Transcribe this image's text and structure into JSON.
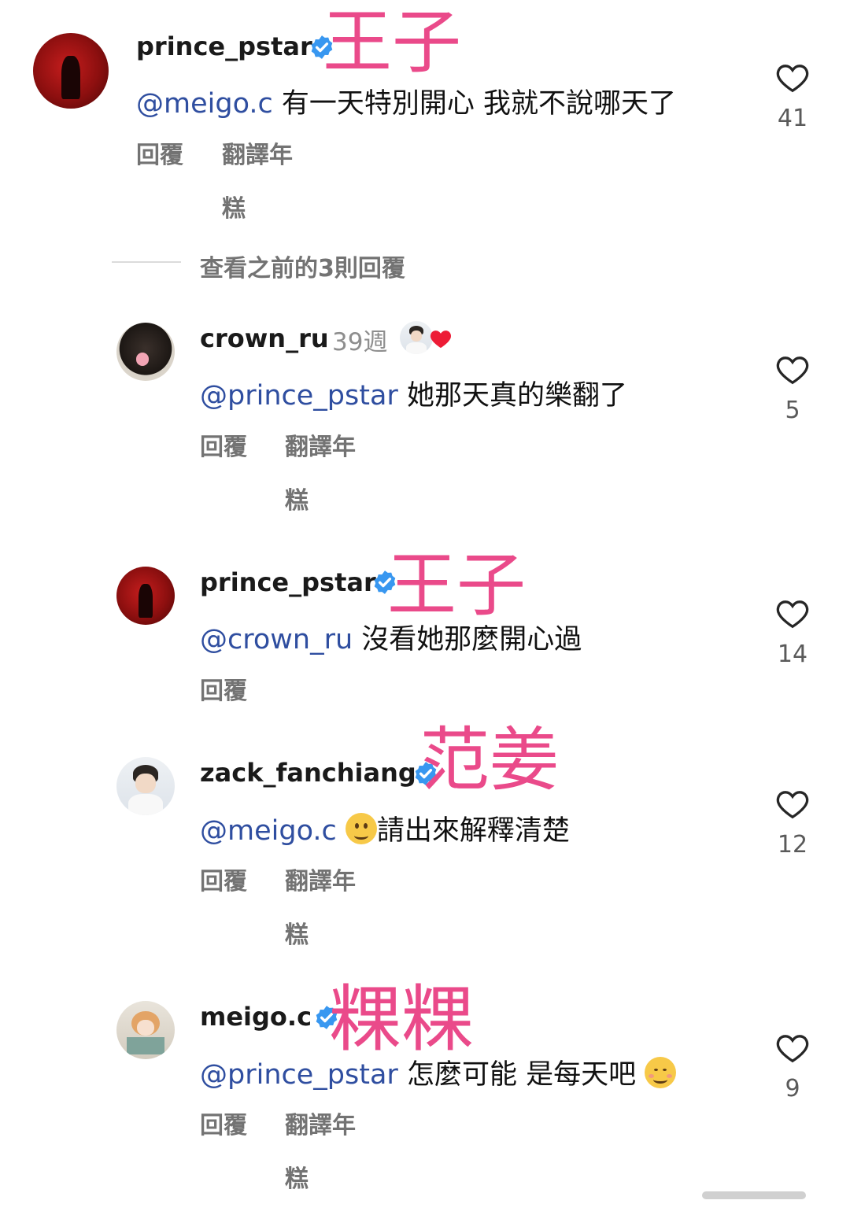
{
  "colors": {
    "overlay": "#ea4a8a",
    "mention": "#2f4ea0",
    "verified": "#3897f0",
    "heart_stroke": "#262626"
  },
  "icons": {
    "like": "heart-outline-icon",
    "verified": "verified-badge-icon",
    "mention_prefix": "threads-at-icon"
  },
  "thread": {
    "view_previous_replies": "查看之前的3則回覆",
    "comments": [
      {
        "username": "prince_pstar",
        "verified": true,
        "overlay_label": "王子",
        "mention": "meigo.c",
        "text": " 有一天特別開心 我就不說哪天了",
        "like_count": "41",
        "reply_label": "回覆",
        "translate_label_line1": "翻譯年",
        "translate_label_line2": "糕"
      },
      {
        "username": "crown_ru",
        "time": "39週",
        "liked_by_author": true,
        "mention": "prince_pstar",
        "text": " 她那天真的樂翻了",
        "like_count": "5",
        "reply_label": "回覆",
        "translate_label_line1": "翻譯年",
        "translate_label_line2": "糕"
      },
      {
        "username": "prince_pstar",
        "verified": true,
        "overlay_label": "王子",
        "mention": "crown_ru",
        "text": " 沒看她那麼開心過",
        "like_count": "14",
        "reply_label": "回覆"
      },
      {
        "username": "zack_fanchiang",
        "verified": true,
        "overlay_label": "范姜",
        "mention": "meigo.c",
        "emoji": "slightly-smiling-face",
        "text": "請出來解釋清楚",
        "like_count": "12",
        "reply_label": "回覆",
        "translate_label_line1": "翻譯年",
        "translate_label_line2": "糕"
      },
      {
        "username": "meigo.c",
        "verified": true,
        "overlay_label": "粿粿",
        "mention": "prince_pstar",
        "text": " 怎麼可能 是每天吧",
        "emoji": "smiling-face",
        "like_count": "9",
        "reply_label": "回覆",
        "translate_label_line1": "翻譯年",
        "translate_label_line2": "糕"
      }
    ]
  }
}
